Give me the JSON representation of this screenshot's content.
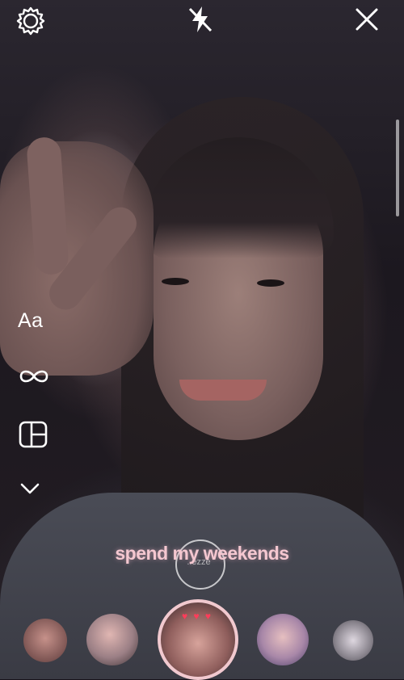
{
  "top_bar": {
    "settings_icon": "gear-icon",
    "flash_icon": "flash-off-icon",
    "close_icon": "close-icon"
  },
  "side_tools": {
    "text_label": "Aa",
    "boomerang_icon": "infinity-icon",
    "layout_icon": "layout-icon",
    "more_icon": "chevron-down-icon"
  },
  "overlay": {
    "lyric_text": "spend my weekends",
    "shutter_label": "..ezze"
  },
  "filters": [
    {
      "name": "filter-1"
    },
    {
      "name": "filter-2"
    },
    {
      "name": "filter-selected"
    },
    {
      "name": "filter-4"
    },
    {
      "name": "filter-5"
    }
  ],
  "colors": {
    "lyric": "#f4c7d0",
    "selected_ring": "#f1c9cf"
  }
}
